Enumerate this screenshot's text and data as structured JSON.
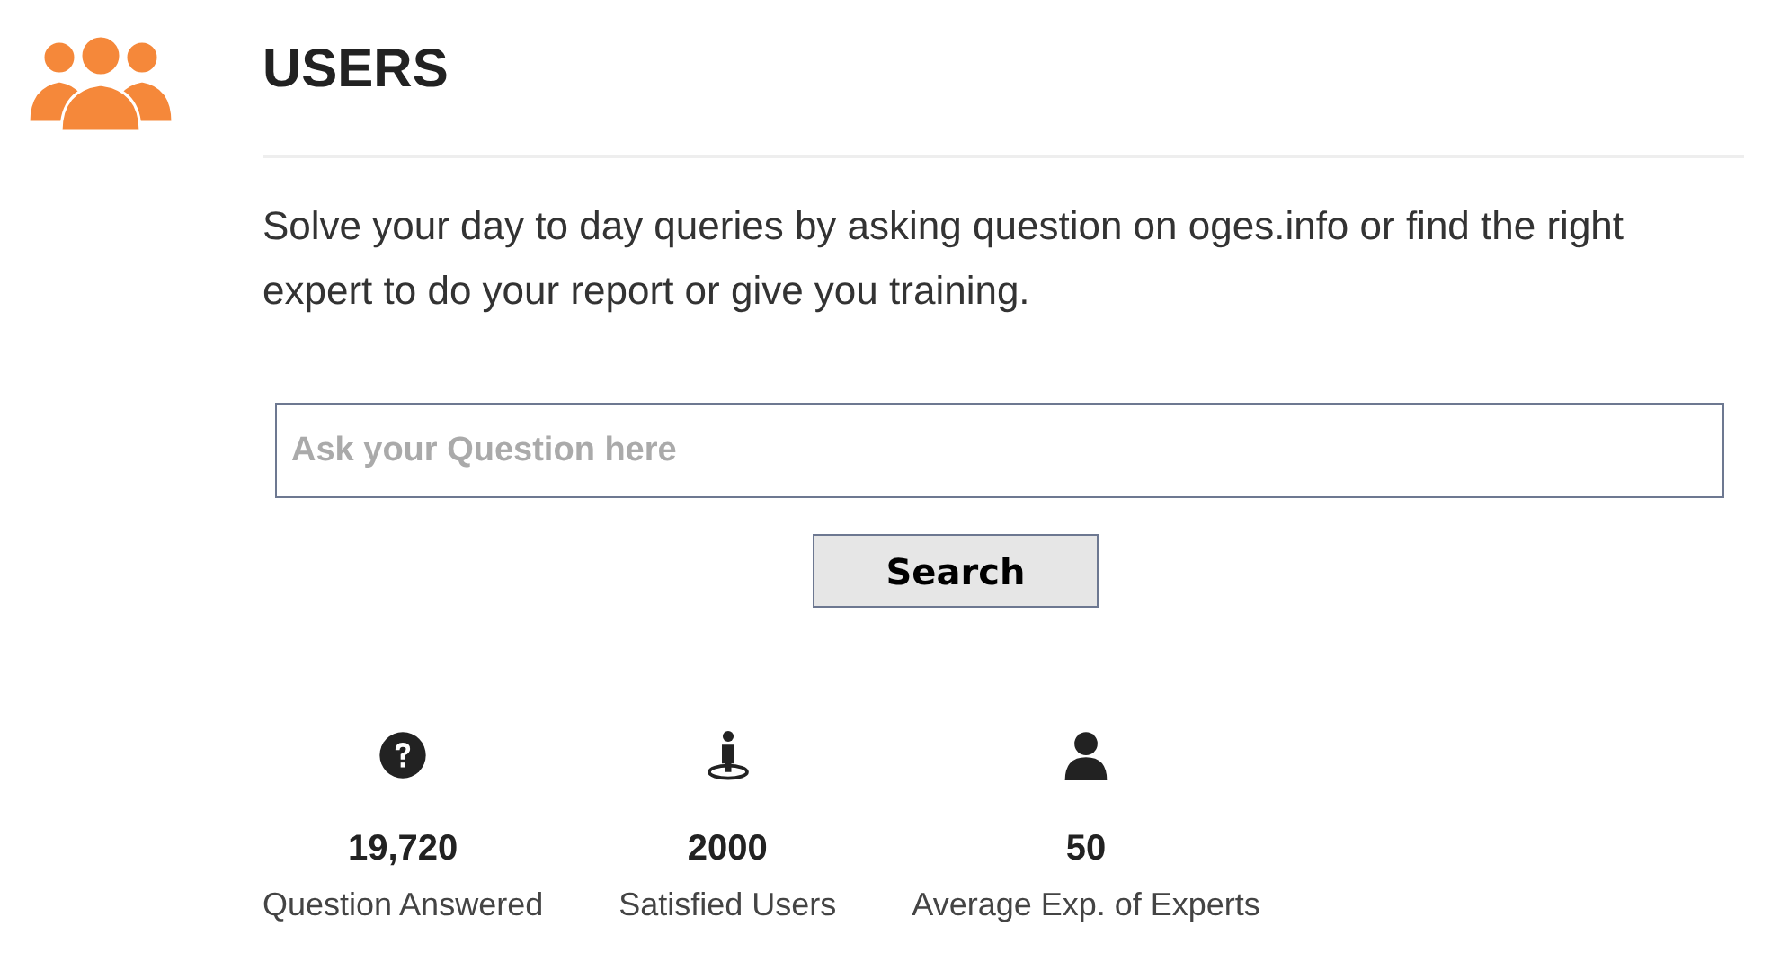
{
  "title": "USERS",
  "description": "Solve your day to day queries by asking question on oges.info or find the right expert to do your report or give you training.",
  "search": {
    "placeholder": "Ask your Question here",
    "button": "Search"
  },
  "stats": [
    {
      "kind": "question",
      "value": "19,720",
      "label": "Question Answered"
    },
    {
      "kind": "person-marker",
      "value": "2000",
      "label": "Satisfied Users"
    },
    {
      "kind": "user",
      "value": "50",
      "label": "Average Exp. of Experts"
    }
  ]
}
